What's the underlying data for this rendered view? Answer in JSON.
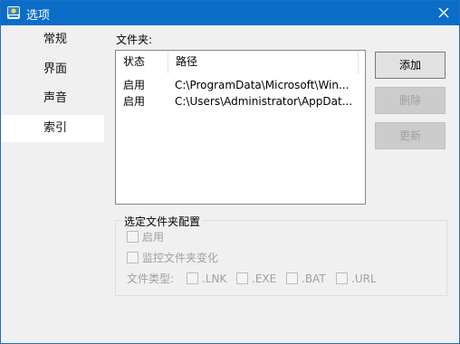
{
  "window": {
    "title": "选项"
  },
  "sidebar": {
    "items": [
      {
        "label": "常规"
      },
      {
        "label": "界面"
      },
      {
        "label": "声音"
      },
      {
        "label": "索引"
      }
    ]
  },
  "folders": {
    "label": "文件夹:",
    "columns": [
      "状态",
      "路径"
    ],
    "rows": [
      {
        "status": "启用",
        "path": "C:\\ProgramData\\Microsoft\\Win..."
      },
      {
        "status": "启用",
        "path": "C:\\Users\\Administrator\\AppDat..."
      }
    ]
  },
  "buttons": {
    "add": "添加",
    "remove": "删除",
    "update": "更新"
  },
  "config": {
    "title": "选定文件夹配置",
    "enable": "启用",
    "monitor": "监控文件夹变化",
    "file_types_label": "文件类型:",
    "types": [
      ".LNK",
      ".EXE",
      ".BAT",
      ".URL"
    ]
  },
  "colors": {
    "titlebar": "#0a6dc8",
    "sidebar_active": "#ffffff",
    "disabled_text": "#a0a0a0"
  }
}
